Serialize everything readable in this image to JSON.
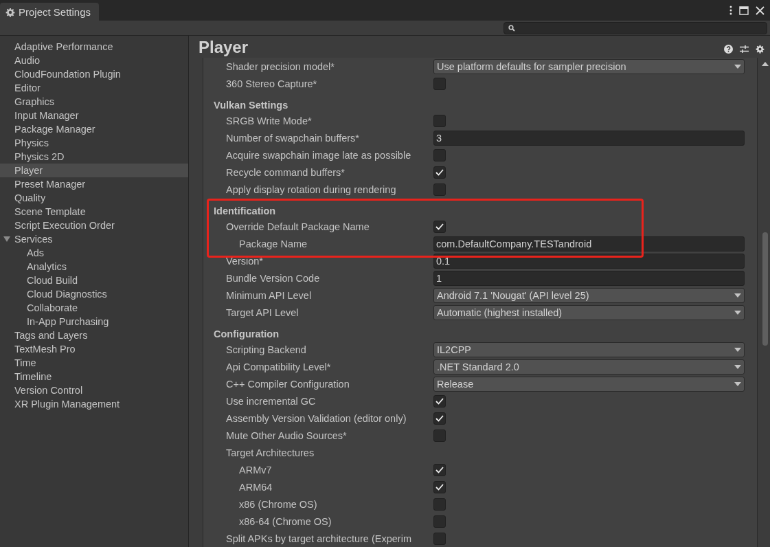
{
  "window": {
    "title": "Project Settings"
  },
  "sidebar": {
    "items": [
      {
        "label": "Adaptive Performance",
        "selected": false
      },
      {
        "label": "Audio",
        "selected": false
      },
      {
        "label": "CloudFoundation Plugin",
        "selected": false
      },
      {
        "label": "Editor",
        "selected": false
      },
      {
        "label": "Graphics",
        "selected": false
      },
      {
        "label": "Input Manager",
        "selected": false
      },
      {
        "label": "Package Manager",
        "selected": false
      },
      {
        "label": "Physics",
        "selected": false
      },
      {
        "label": "Physics 2D",
        "selected": false
      },
      {
        "label": "Player",
        "selected": true
      },
      {
        "label": "Preset Manager",
        "selected": false
      },
      {
        "label": "Quality",
        "selected": false
      },
      {
        "label": "Scene Template",
        "selected": false
      },
      {
        "label": "Script Execution Order",
        "selected": false
      },
      {
        "label": "Services",
        "selected": false,
        "expanded": true,
        "children": [
          {
            "label": "Ads",
            "selected": false
          },
          {
            "label": "Analytics",
            "selected": false
          },
          {
            "label": "Cloud Build",
            "selected": false
          },
          {
            "label": "Cloud Diagnostics",
            "selected": false
          },
          {
            "label": "Collaborate",
            "selected": false
          },
          {
            "label": "In-App Purchasing",
            "selected": false
          }
        ]
      },
      {
        "label": "Tags and Layers",
        "selected": false
      },
      {
        "label": "TextMesh Pro",
        "selected": false
      },
      {
        "label": "Time",
        "selected": false
      },
      {
        "label": "Timeline",
        "selected": false
      },
      {
        "label": "Version Control",
        "selected": false
      },
      {
        "label": "XR Plugin Management",
        "selected": false
      }
    ]
  },
  "page": {
    "title": "Player"
  },
  "sections": [
    {
      "rows": [
        {
          "kind": "dropdown",
          "label": "Shader precision model*",
          "value": "Use platform defaults for sampler precision",
          "highlighted": false
        },
        {
          "kind": "checkbox",
          "label": "360 Stereo Capture*",
          "checked": false,
          "highlighted": false
        }
      ]
    },
    {
      "title": "Vulkan Settings",
      "rows": [
        {
          "kind": "checkbox",
          "label": "SRGB Write Mode*",
          "checked": false,
          "highlighted": false
        },
        {
          "kind": "field",
          "label": "Number of swapchain buffers*",
          "value": "3",
          "highlighted": false
        },
        {
          "kind": "checkbox",
          "label": "Acquire swapchain image late as possible",
          "checked": false,
          "highlighted": false
        },
        {
          "kind": "checkbox",
          "label": "Recycle command buffers*",
          "checked": true,
          "highlighted": false
        },
        {
          "kind": "checkbox",
          "label": "Apply display rotation during rendering",
          "checked": false,
          "highlighted": false
        }
      ]
    },
    {
      "title": "Identification",
      "rows": [
        {
          "kind": "checkbox",
          "label": "Override Default Package Name",
          "checked": true,
          "highlighted": true,
          "children": [
            {
              "kind": "field",
              "label": "Package Name",
              "value": "com.DefaultCompany.TESTandroid",
              "highlighted": true
            }
          ]
        },
        {
          "kind": "field",
          "label": "Version*",
          "value": "0.1",
          "highlighted": false
        },
        {
          "kind": "field",
          "label": "Bundle Version Code",
          "value": "1",
          "highlighted": false
        },
        {
          "kind": "dropdown",
          "label": "Minimum API Level",
          "value": "Android 7.1 'Nougat' (API level 25)",
          "highlighted": false
        },
        {
          "kind": "dropdown",
          "label": "Target API Level",
          "value": "Automatic (highest installed)",
          "highlighted": false
        }
      ]
    },
    {
      "title": "Configuration",
      "rows": [
        {
          "kind": "dropdown",
          "label": "Scripting Backend",
          "value": "IL2CPP",
          "highlighted": false
        },
        {
          "kind": "dropdown",
          "label": "Api Compatibility Level*",
          "value": ".NET Standard 2.0",
          "highlighted": false
        },
        {
          "kind": "dropdown",
          "label": "C++ Compiler Configuration",
          "value": "Release",
          "highlighted": false
        },
        {
          "kind": "checkbox",
          "label": "Use incremental GC",
          "checked": true,
          "highlighted": false
        },
        {
          "kind": "checkbox",
          "label": "Assembly Version Validation (editor only)",
          "checked": true,
          "highlighted": false
        },
        {
          "kind": "checkbox",
          "label": "Mute Other Audio Sources*",
          "checked": false,
          "highlighted": false
        },
        {
          "kind": "label",
          "label": "Target Architectures",
          "highlighted": false,
          "children": [
            {
              "kind": "checkbox",
              "label": "ARMv7",
              "checked": true,
              "highlighted": false
            },
            {
              "kind": "checkbox",
              "label": "ARM64",
              "checked": true,
              "highlighted": false
            },
            {
              "kind": "checkbox",
              "label": "x86 (Chrome OS)",
              "checked": false,
              "highlighted": false
            },
            {
              "kind": "checkbox",
              "label": "x86-64 (Chrome OS)",
              "checked": false,
              "highlighted": false
            }
          ]
        },
        {
          "kind": "checkbox",
          "label": "Split APKs by target architecture (Experim",
          "checked": false,
          "highlighted": false
        }
      ]
    }
  ]
}
